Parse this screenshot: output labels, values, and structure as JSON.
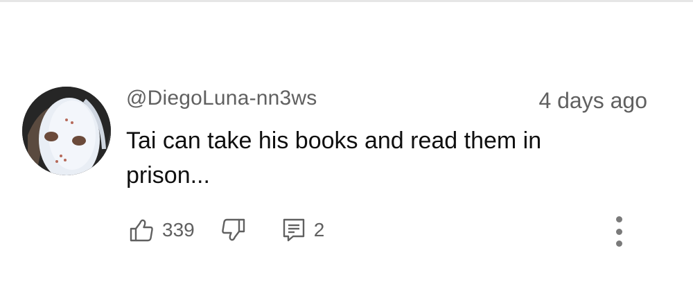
{
  "comment": {
    "author_handle": "@DiegoLuna-nn3ws",
    "posted": "4 days ago",
    "text": "Tai can take his books and read them in prison...",
    "like_count": "339",
    "reply_count": "2"
  },
  "icons": {
    "like": "thumbs-up-icon",
    "dislike": "thumbs-down-icon",
    "reply": "reply-comment-icon",
    "more": "more-vertical-icon"
  },
  "colors": {
    "text_primary": "#0f0f0f",
    "text_secondary": "#606060",
    "icon": "#606060"
  }
}
